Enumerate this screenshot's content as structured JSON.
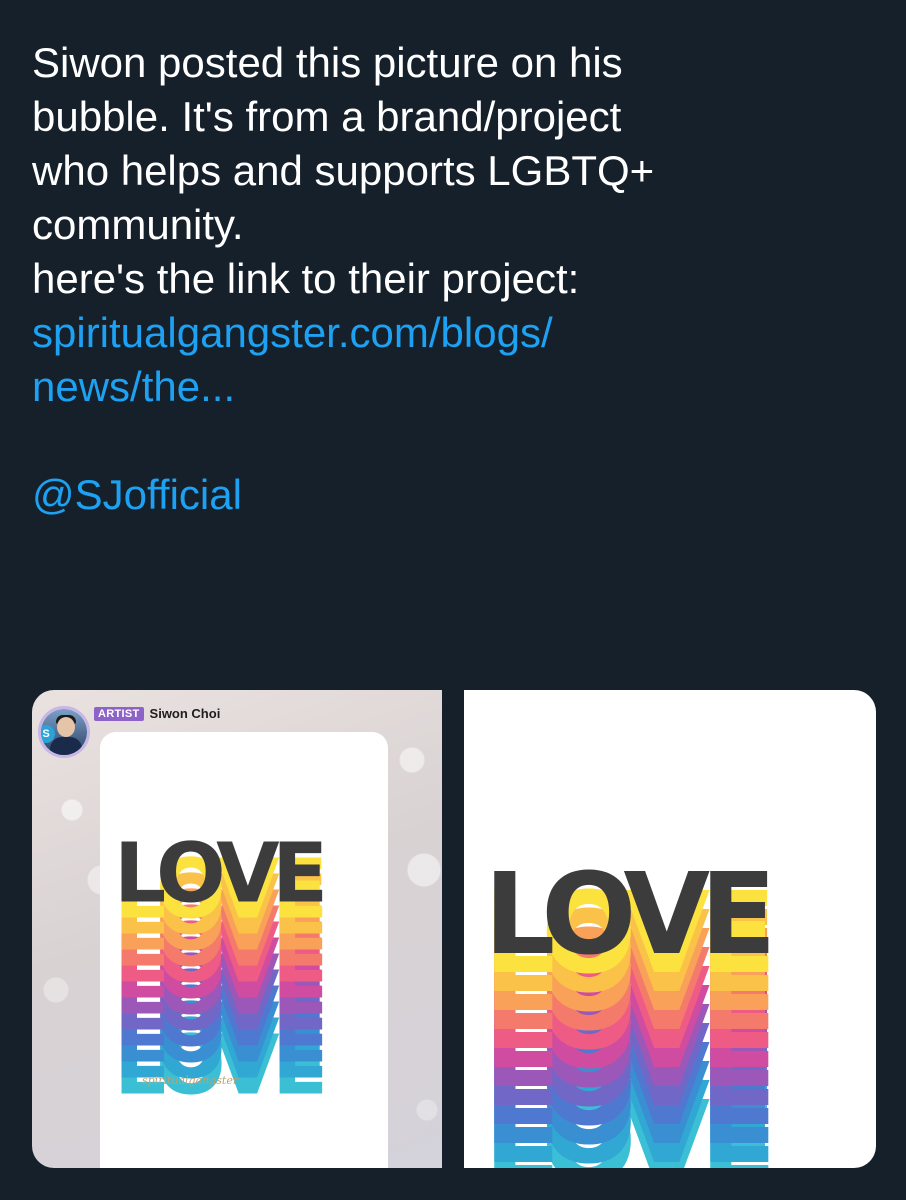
{
  "tweet": {
    "lines": [
      "Siwon posted this picture on his",
      "bubble. It's from a brand/project",
      "who helps and supports LGBTQ+",
      "community.",
      "here's the link to their project:"
    ],
    "link_line1": "spiritualgangster.com/blogs/",
    "link_line2": "news/the...",
    "mention": "@SJofficial"
  },
  "media": {
    "left_image": {
      "badge": "ARTIST",
      "artist_name": "Siwon Choi",
      "artwork_word": "LOVE",
      "signature": "spiritualgangster"
    },
    "right_image": {
      "artwork_word": "LOVE"
    }
  },
  "colors": {
    "background": "#15202b",
    "link": "#1da1f2",
    "badge": "#8e63c9",
    "letters": "#3c3c3c",
    "stripes": [
      "#fbe23f",
      "#fbc249",
      "#f9a059",
      "#f47b6c",
      "#ee5c86",
      "#cf4ca0",
      "#9c58b8",
      "#7067c6",
      "#4f79d0",
      "#398fd2",
      "#31a7d3",
      "#3bbfd5"
    ]
  }
}
